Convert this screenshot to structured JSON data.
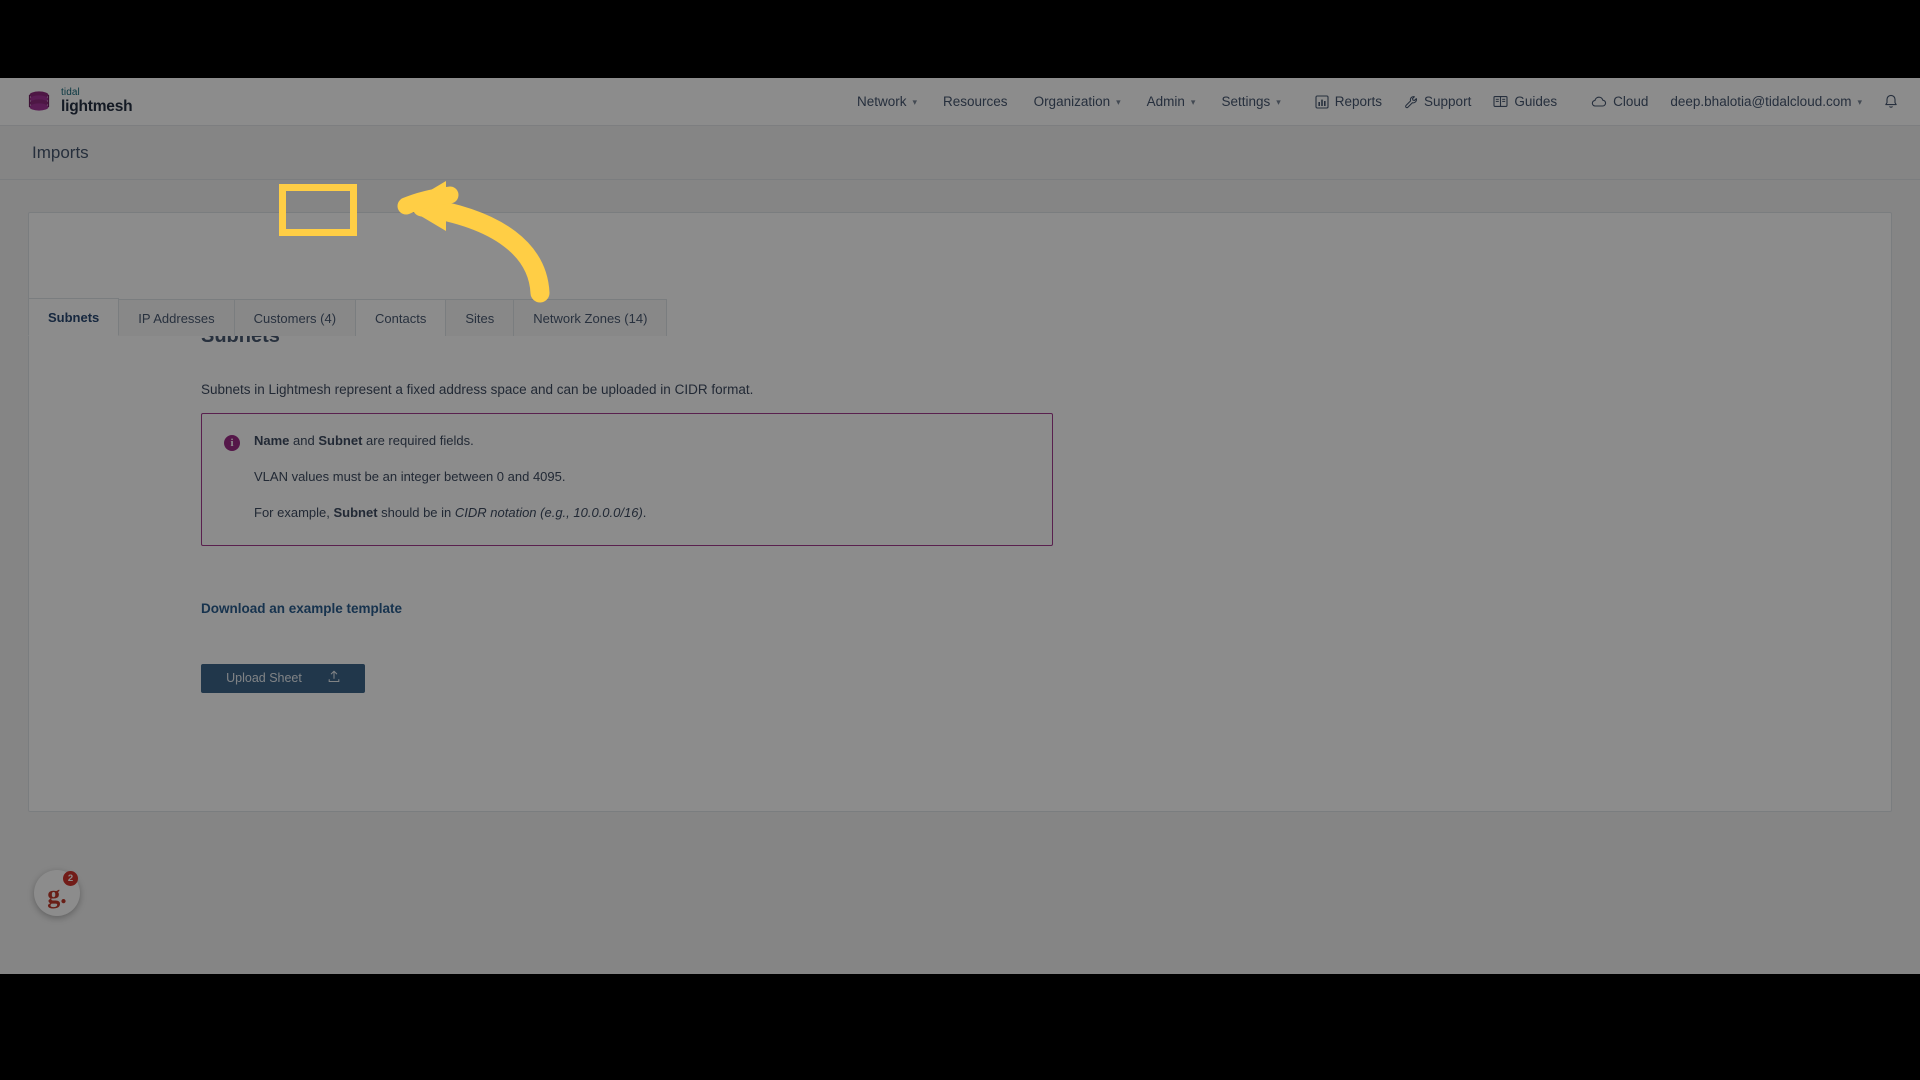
{
  "brand": {
    "top_word": "tidal",
    "bottom_word": "lightmesh",
    "logo_icon": "stacked-discs-logo"
  },
  "topnav": {
    "main_items": [
      {
        "label": "Network",
        "has_caret": true,
        "icon": ""
      },
      {
        "label": "Resources",
        "has_caret": false,
        "icon": ""
      },
      {
        "label": "Organization",
        "has_caret": true,
        "icon": ""
      },
      {
        "label": "Admin",
        "has_caret": true,
        "icon": ""
      },
      {
        "label": "Settings",
        "has_caret": true,
        "icon": ""
      }
    ],
    "right_items": [
      {
        "label": "Reports",
        "icon": "bar-chart-icon"
      },
      {
        "label": "Support",
        "icon": "wrench-icon"
      },
      {
        "label": "Guides",
        "icon": "book-icon"
      },
      {
        "label": "Cloud",
        "icon": "cloud-icon"
      }
    ],
    "account": {
      "email": "deep.bhalotia@tidalcloud.com",
      "caret": "⌄",
      "bell_icon": "bell-icon"
    }
  },
  "page": {
    "title": "Imports"
  },
  "tabs": [
    {
      "label": "Subnets",
      "active": true,
      "highlighted": false
    },
    {
      "label": "IP Addresses",
      "active": false,
      "highlighted": false
    },
    {
      "label": "Customers (4)",
      "active": false,
      "highlighted": false
    },
    {
      "label": "Contacts",
      "active": false,
      "highlighted": true
    },
    {
      "label": "Sites",
      "active": false,
      "highlighted": false
    },
    {
      "label": "Network Zones (14)",
      "active": false,
      "highlighted": false
    }
  ],
  "main": {
    "section_title": "Subnets",
    "description": "Subnets in Lightmesh represent a fixed address space and can be uploaded in CIDR format.",
    "info_box": {
      "icon": "info-circle-icon",
      "line1_a": "Name",
      "line1_b": " and ",
      "line1_c": "Subnet",
      "line1_d": " are required fields.",
      "line2": "VLAN values must be an integer between 0 and 4095.",
      "line3_a": "For example, ",
      "line3_b": "Subnet",
      "line3_c": " should be in ",
      "line3_d": "CIDR notation (e.g., 10.0.0.0/16)",
      "line3_e": "."
    },
    "download_link": "Download an example template",
    "upload_button": {
      "label": "Upload Sheet",
      "icon": "upload-icon"
    }
  },
  "help_widget": {
    "glyph": "g.",
    "badge_count": "2"
  },
  "annotation": {
    "type": "arrow-pointing-left",
    "color": "#FFCE45",
    "target": "Contacts"
  },
  "colors": {
    "accent_purple": "#9C2B86",
    "brand_teal": "#17697A",
    "brand_navy": "#263043",
    "button_blue": "#3C6489",
    "link_blue": "#2A5D8F",
    "highlight_yellow": "#FFCE45"
  }
}
